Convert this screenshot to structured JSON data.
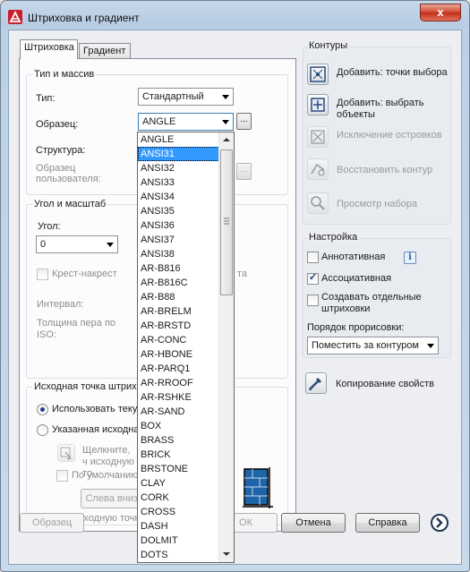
{
  "window": {
    "title": "Штриховка и градиент",
    "close_label": "x"
  },
  "tabs": [
    {
      "label": "Штриховка"
    },
    {
      "label": "Градиент"
    }
  ],
  "type_pattern": {
    "legend": "Тип и массив",
    "type_label": "Тип:",
    "type_value": "Стандартный",
    "pattern_label": "Образец:",
    "pattern_value": "ANGLE",
    "structure_label": "Структура:",
    "custom_pattern_label": "Образец пользователя:",
    "dots": "..."
  },
  "angle_scale": {
    "legend": "Угол и масштаб",
    "angle_label": "Угол:",
    "angle_value": "0",
    "cross_label": "Крест-накрест",
    "cross_suffix": "та",
    "interval_label": "Интервал:",
    "pen_width_label": "Толщина пера по ISO:"
  },
  "origin": {
    "legend": "Исходная точка штрих",
    "use_current_label": "Использовать теку",
    "specified_label": "Указанная исходна",
    "click_text": "Щелкните, ч исходную то",
    "default_label": "По умолчанию",
    "bottom_left_button": "Слева внизу",
    "store_label": "Исходную точку"
  },
  "contours": {
    "legend": "Контуры",
    "add_pick_label": "Добавить: точки выбора",
    "add_select_label": "Добавить: выбрать объекты",
    "islands_label": "Исключение островков",
    "recreate_label": "Восстановить контур",
    "view_label": "Просмотр набора"
  },
  "settings": {
    "legend": "Настройка",
    "annotative_label": "Аннотативная",
    "annotative_checked": false,
    "info_glyph": "i",
    "associative_label": "Ассоциативная",
    "associative_checked": true,
    "separate_label": "Создавать отдельные штриховки",
    "separate_checked": false,
    "draw_order_label": "Порядок прорисовки:",
    "draw_order_value": "Поместить за контуром"
  },
  "inherit_label": "Копирование свойств",
  "footer": {
    "preview_button": "Образец",
    "ok_button": "ОК",
    "cancel_button": "Отмена",
    "help_button": "Справка"
  },
  "pattern_dropdown": {
    "items": [
      "ANGLE",
      "ANSI31",
      "ANSI32",
      "ANSI33",
      "ANSI34",
      "ANSI35",
      "ANSI36",
      "ANSI37",
      "ANSI38",
      "AR-B816",
      "AR-B816C",
      "AR-B88",
      "AR-BRELM",
      "AR-BRSTD",
      "AR-CONC",
      "AR-HBONE",
      "AR-PARQ1",
      "AR-RROOF",
      "AR-RSHKE",
      "AR-SAND",
      "BOX",
      "BRASS",
      "BRICK",
      "BRSTONE",
      "CLAY",
      "CORK",
      "CROSS",
      "DASH",
      "DOLMIT",
      "DOTS"
    ],
    "selected_index": 1
  },
  "colors": {
    "selection": "#3399ff",
    "window_frame": "#c6d7e9",
    "client": "#eceef2"
  }
}
